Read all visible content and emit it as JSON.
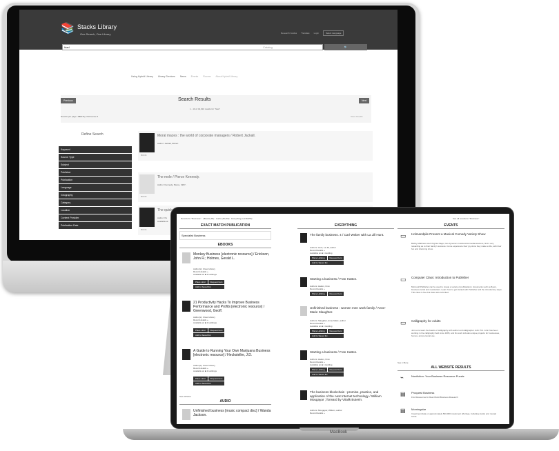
{
  "desktop": {
    "logo": {
      "title": "Stacks Library",
      "subtitle": "One Search, One Library"
    },
    "header_links": [
      "Research Guides",
      "Translate",
      "Login"
    ],
    "header_select": "Select Language",
    "search": {
      "query": "hiad",
      "scope": "Catalog"
    },
    "nav": [
      "Using Hybrid Library",
      "Library Services",
      "News",
      "Events",
      "Rooms",
      "About Hybrid Library"
    ],
    "results": {
      "title": "Search Results",
      "count": "1 - 10 of 44,910 results for \"hiad\"",
      "prev": "Previous",
      "next": "Next",
      "per_page": "Results per page: 10 ▾",
      "sort": "Sort By: Relevance ▾",
      "rss": "Save Results"
    },
    "refine_title": "Refine Search",
    "facets": [
      "Keyword",
      "Source Type",
      "Subject",
      "Publisher",
      "Publication",
      "Language",
      "Geography",
      "Category",
      "Location",
      "Content Provider",
      "Publication Date"
    ],
    "records": [
      {
        "title": "Moral mazes : the world of corporate managers / Robert Jackall.",
        "author": "Author: Jackall, Robert",
        "pub": "",
        "format": "BOOK"
      },
      {
        "title": "The mole / Pierce Kennedy.",
        "author": "Author: Kennedy, Pierce, 1967-",
        "pub": "",
        "format": "BOOK"
      },
      {
        "title": "The quickening",
        "author": "Author: Pe",
        "pub": "Available at",
        "format": "BOOK"
      }
    ]
  },
  "laptop": {
    "top_info": "Results for \"Business\" · eBooks (84) · Audio (48,493) · Everything (1,018,556)",
    "see_all": "See all results for \"Business\"",
    "col1": {
      "heading": "EXACT MATCH PUBLICATION",
      "exact": "Specialist Business",
      "ebooks_heading": "EBOOKS",
      "items": [
        {
          "title": "Monkey Business [electronic resource] / Erickson, John R.; Holmes, Gerald L.",
          "meta": [
            "Author(s): Cloud Library",
            "Record details »",
            "Available at: ■ 1 Holdings"
          ],
          "btn1": "Place Hold",
          "btn2": "Request Item",
          "btn3": "Add to Saved list"
        },
        {
          "title": "21 Productivity Hacks To Improve Business Performance and Profits [electronic resource] / Greenwood, Geoff.",
          "meta": [
            "Author(s): Cloud Library",
            "Record details »",
            "Available at: ■ 1 Holdings"
          ],
          "btn1": "Place Hold",
          "btn2": "Request Item",
          "btn3": "Add to Saved list"
        },
        {
          "title": "A Guide to Running Your Own Marijuana Business [electronic resource] / Hecksteller, J.D.",
          "meta": [
            "Author(s): Cloud Library",
            "Record details »",
            "Available at: ■ 1 Holdings"
          ],
          "btn1": "Place Hold",
          "btn2": "Request Item",
          "btn3": "Add to Saved list"
        }
      ],
      "see_all": "See All More",
      "audio_heading": "AUDIO",
      "audio_item": "Unfinished business [music compact disc] / Wanda Jackson."
    },
    "col2": {
      "heading": "EVERYTHING",
      "items": [
        {
          "title": "The family business. 4 / Carl Weber with La Jill Hunt.",
          "meta": [
            "Authors: Hunt, La Jill, author",
            "Record details »",
            "Available at: ■ 1 Holding"
          ],
          "btn1": "Place Holding",
          "btn2": "Request Item",
          "btn3": "Add to Saved list",
          "cover": "dark"
        },
        {
          "title": "Starting a business / Fran Hatton.",
          "meta": [
            "Authors: Hatton, Fran",
            "Record details »"
          ],
          "btn1": "Place Holding",
          "btn2": "Request Item",
          "btn3": "",
          "cover": "dark"
        },
        {
          "title": "Unfinished business : women men work family / Anne-Marie Slaughter.",
          "meta": [
            "Authors: Slaughter, Anne-Marie, author",
            "Record details »",
            "Available at: ■ 1 Holding"
          ],
          "btn1": "Place Holding",
          "btn2": "Request Item",
          "btn3": "Add to Saved list",
          "cover": "light"
        },
        {
          "title": "Starting a business / Fran Hatton.",
          "meta": [
            "Authors: Hatton, Fran",
            "Record details »",
            "Available at: ■ 1 Holding"
          ],
          "btn1": "Place Holding",
          "btn2": "Request Item",
          "btn3": "Add to Saved list",
          "cover": "dark"
        },
        {
          "title": "The business blockchain : promise, practice, and application of the next Internet technology / William Mougayar ; forward by Vitalik Buterin.",
          "meta": [
            "Authors: Mougayar, William, author",
            "Record details »"
          ],
          "btn1": "",
          "btn2": "",
          "btn3": "",
          "cover": "dark"
        }
      ]
    },
    "col3": {
      "heading": "EVENTS",
      "events": [
        {
          "title": "Holmandpile Present a Musical Comedy Variety Show",
          "desc": "Bobby Matthews and Virginia Nagel, two dynamic musicians/comedians/actors, find it very rewarding as to their family's success. Come experience their joy show they made to life, with their fun and charming show."
        },
        {
          "title": "Computer Class: Introduction to Publisher",
          "desc": "Microsoft Publisher can be used to create a variety of publications: documents such as flyers, business cards and newsletters. Learn how to get started with Publisher and the introductory steps. This class is free but class size is limited."
        },
        {
          "title": "Calligraphy for Adults",
          "desc": "Join us to learn the basics of calligraphy with author and calligrapher John Pitz. John has been working in the calligraphy field since 1995, and his work includes unique projects for businesses, homes, and personal use."
        }
      ],
      "see_more": "See 1 More",
      "web_heading": "ALL WEBSITE RESULTS",
      "web": [
        {
          "title": "Nonfiction: Your Business Resource Puzzle",
          "desc": ""
        },
        {
          "title": "Proquest Business",
          "desc": "Find Resources for Real World Business Research"
        },
        {
          "title": "Morningstar",
          "desc": "Investment data on approximately 500,000 investment offerings, including stocks and mutual funds."
        }
      ]
    },
    "brand": "MacBook"
  }
}
